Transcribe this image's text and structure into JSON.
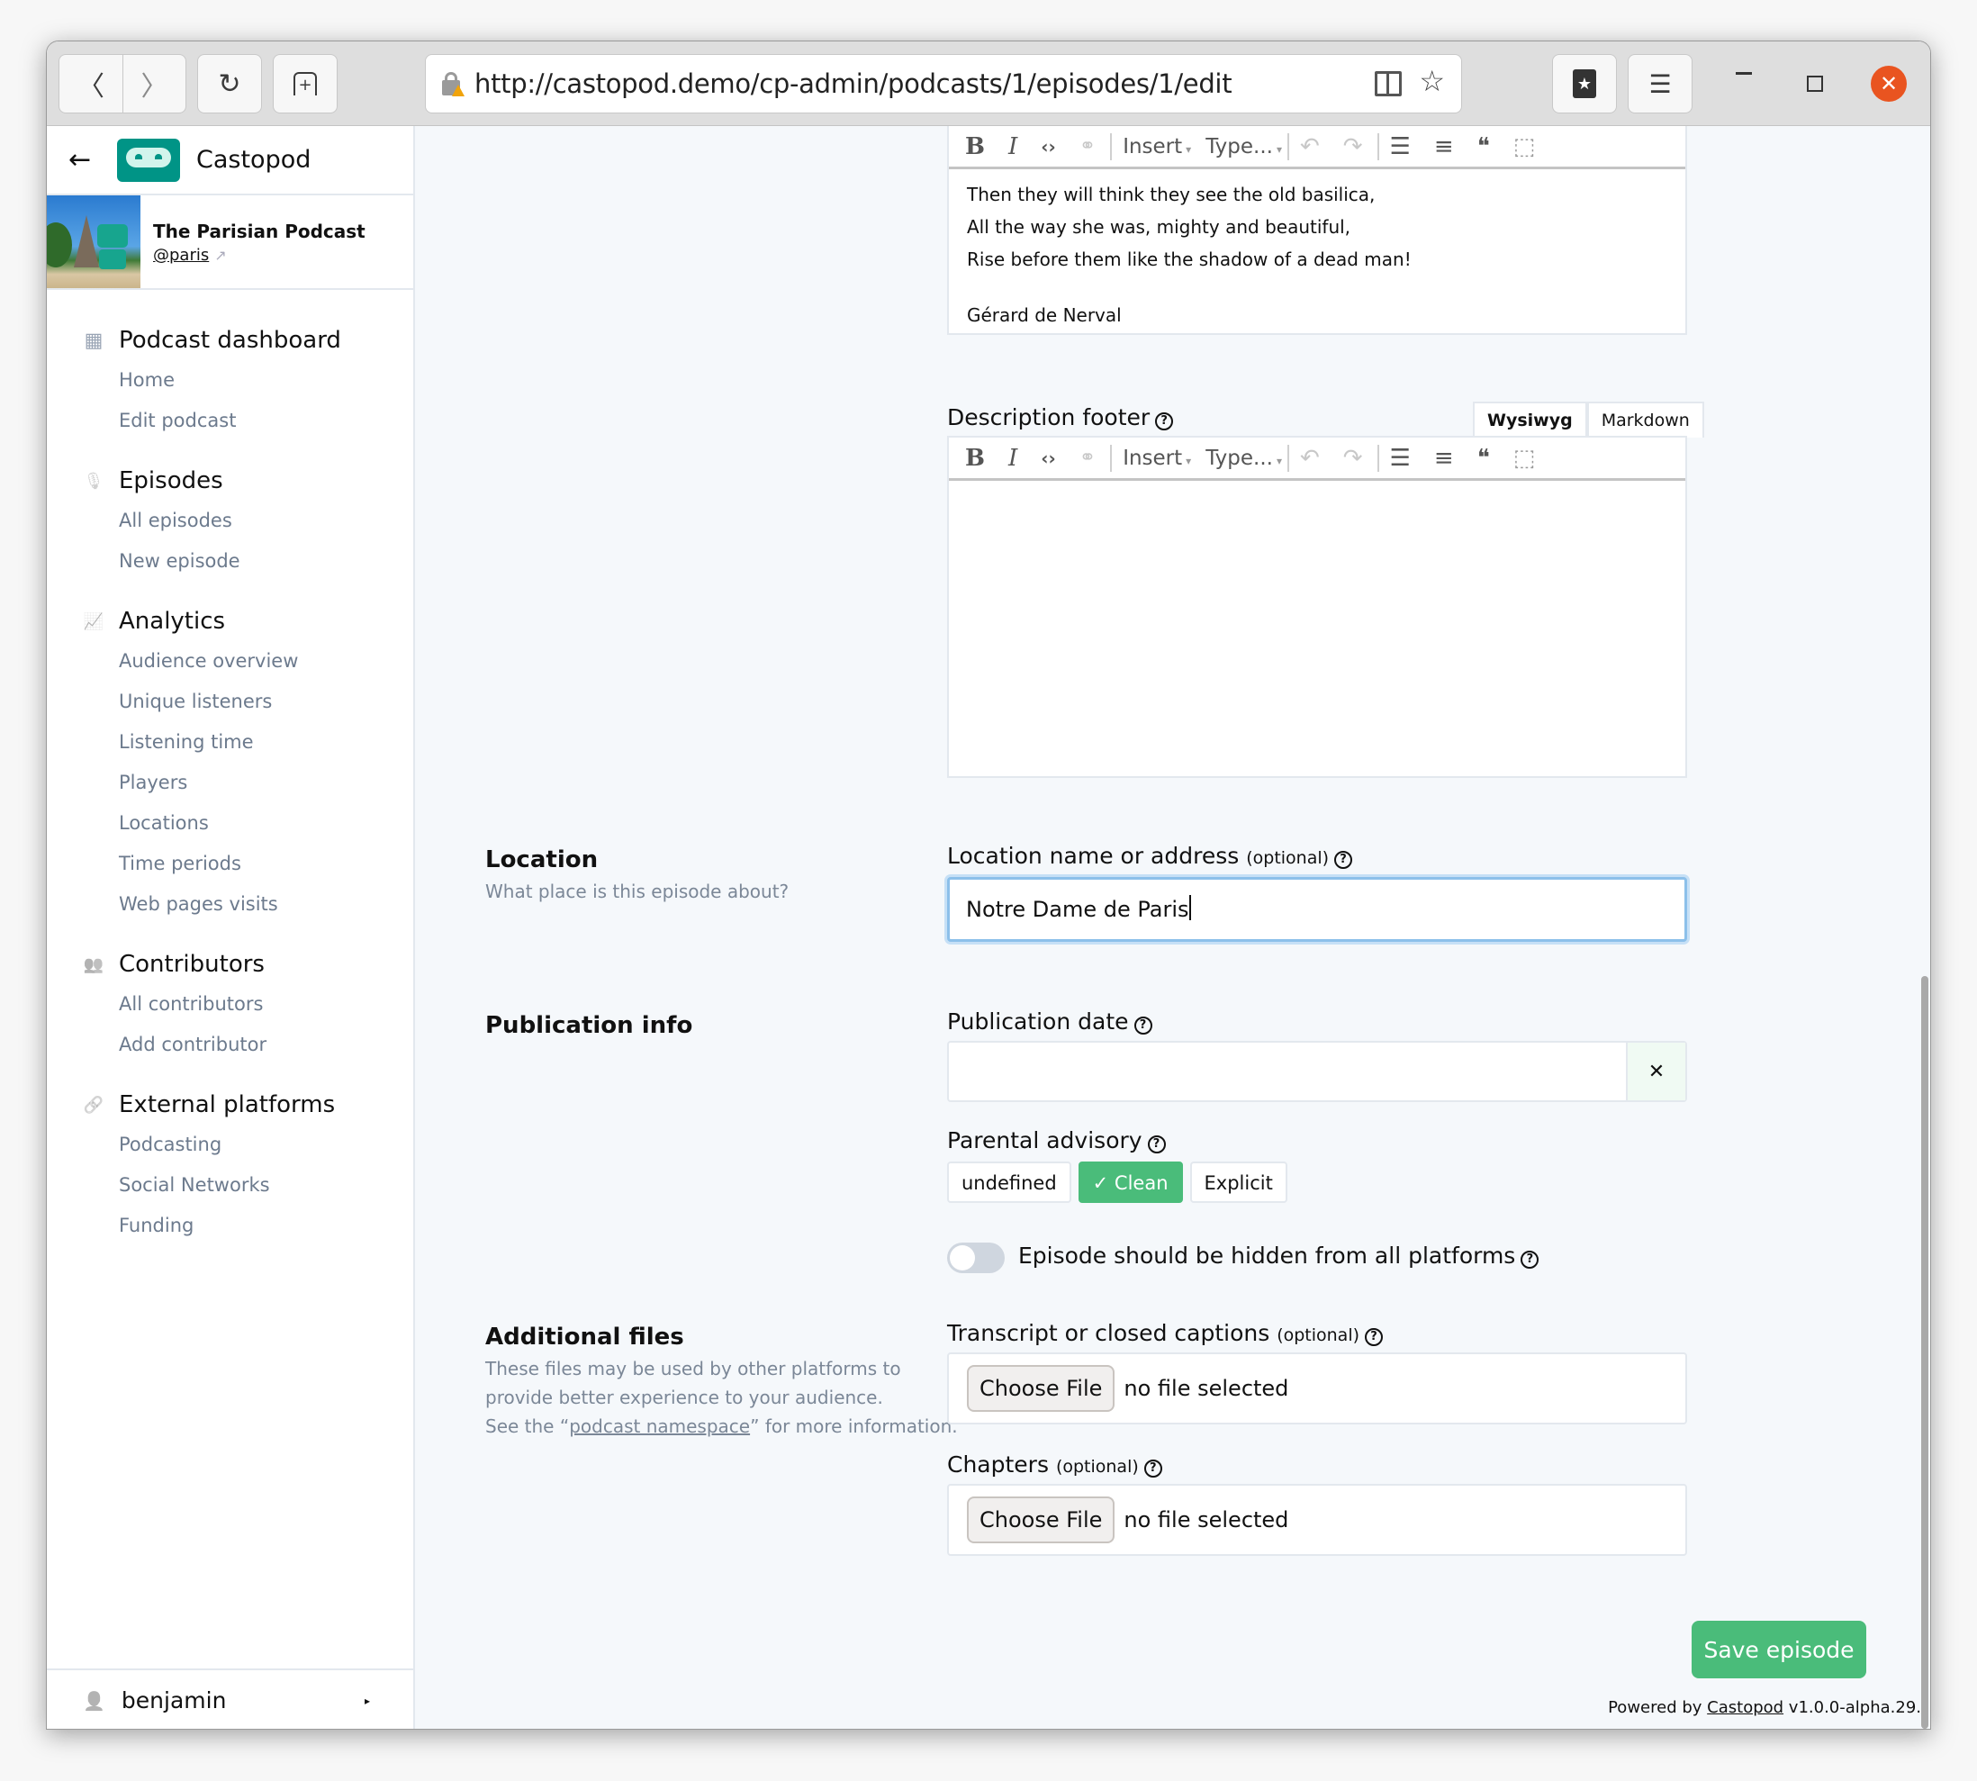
{
  "browser": {
    "url": "http://castopod.demo/cp-admin/podcasts/1/episodes/1/edit",
    "buttons": {
      "back": "〈",
      "forward": "〉",
      "reload": "↻",
      "new_tab": "+",
      "menu": "☰",
      "close": "✕",
      "star": "☆"
    }
  },
  "sidebar": {
    "back_arrow": "←",
    "brand": "Castopod",
    "podcast": {
      "title": "The Parisian Podcast",
      "handle": "@paris",
      "external_icon": "↗"
    },
    "groups": [
      {
        "icon": "▦",
        "label": "Podcast dashboard",
        "items": [
          "Home",
          "Edit podcast"
        ]
      },
      {
        "icon": "🎙",
        "label": "Episodes",
        "items": [
          "All episodes",
          "New episode"
        ]
      },
      {
        "icon": "📈",
        "label": "Analytics",
        "items": [
          "Audience overview",
          "Unique listeners",
          "Listening time",
          "Players",
          "Locations",
          "Time periods",
          "Web pages visits"
        ]
      },
      {
        "icon": "👥",
        "label": "Contributors",
        "items": [
          "All contributors",
          "Add contributor"
        ]
      },
      {
        "icon": "🔗",
        "label": "External platforms",
        "items": [
          "Podcasting",
          "Social Networks",
          "Funding"
        ]
      }
    ],
    "user": {
      "icon": "👤",
      "name": "benjamin",
      "caret": "▸"
    }
  },
  "editor_toolbar": {
    "bold": "B",
    "italic": "I",
    "code": "‹›",
    "link": "⚭",
    "insert": "Insert",
    "type": "Type...",
    "dropdown_arrow": "▾",
    "undo": "↶",
    "redo": "↷",
    "bullet_list": "☰",
    "ordered_list": "≡",
    "quote": "❝",
    "select": "⬚"
  },
  "description": {
    "lines": [
      "Then they will think they see the old basilica,",
      "All the way she was, mighty and beautiful,",
      "Rise before them like the shadow of a dead man!",
      "",
      "Gérard de Nerval"
    ]
  },
  "description_footer": {
    "label": "Description footer",
    "tabs": [
      "Wysiwyg",
      "Markdown"
    ],
    "active_tab": "Wysiwyg",
    "content": ""
  },
  "location": {
    "section_title": "Location",
    "section_subtitle": "What place is this episode about?",
    "label": "Location name or address",
    "optional": "(optional)",
    "value": "Notre Dame de Paris"
  },
  "publication": {
    "section_title": "Publication info",
    "date_label": "Publication date",
    "date_value": "",
    "clear": "✕",
    "parental_label": "Parental advisory",
    "parental_options": [
      "undefined",
      "✓ Clean",
      "Explicit"
    ],
    "parental_selected": "Clean",
    "hidden_toggle_label": "Episode should be hidden from all platforms",
    "hidden_toggle_on": false
  },
  "additional_files": {
    "section_title": "Additional files",
    "section_subtitle_1": "These files may be used by other platforms to",
    "section_subtitle_2": "provide better experience to your audience.",
    "section_subtitle_3_pre": "See the “",
    "section_subtitle_link": "podcast namespace",
    "section_subtitle_3_post": "” for more information.",
    "transcript_label": "Transcript or closed captions",
    "chapters_label": "Chapters",
    "optional": "(optional)",
    "choose_file": "Choose File",
    "no_file": "no file selected"
  },
  "actions": {
    "save": "Save episode"
  },
  "footer": {
    "prefix": "Powered by ",
    "link": "Castopod",
    "suffix": " v1.0.0-alpha.29."
  },
  "colors": {
    "accent": "#4abc7a",
    "brand": "#009486",
    "focus": "#8cc0ea"
  }
}
